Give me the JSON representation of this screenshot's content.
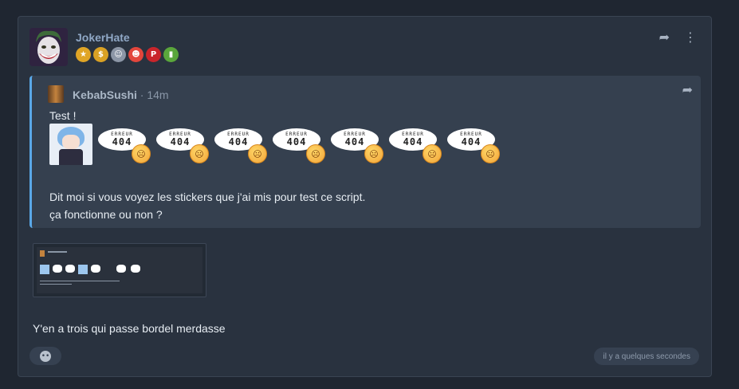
{
  "post": {
    "author": "JokerHate",
    "badges": [
      {
        "icon": "star-badge-icon",
        "glyph": "★",
        "color": "#e0a526"
      },
      {
        "icon": "dollar-badge-icon",
        "glyph": "$",
        "color": "#d9a124"
      },
      {
        "icon": "portrait-badge-icon",
        "glyph": "☺",
        "color": "#8c96a6"
      },
      {
        "icon": "clown-badge-icon",
        "glyph": "☻",
        "color": "#e3463c"
      },
      {
        "icon": "wp-badge-icon",
        "glyph": "P",
        "color": "#c9252b"
      },
      {
        "icon": "trash-badge-icon",
        "glyph": "▮",
        "color": "#5aa63b"
      }
    ],
    "actions": {
      "share_icon": "share-icon",
      "more_icon": "more-vertical-icon"
    },
    "quote": {
      "author": "KebabSushi",
      "time": "14m",
      "line1": "Test !",
      "sticker_word": "ERREUR",
      "sticker_code": "404",
      "line2": "Dit moi si vous voyez les stickers que j'ai mis pour test ce script.",
      "line3": "ça fonctionne ou non ?"
    },
    "body_text": "Y'en a trois qui passe bordel merdasse",
    "timestamp": "il y a quelques secondes",
    "colors": {
      "accent": "#5aa8e8",
      "card": "#29323f",
      "quote_bg": "#35404f"
    }
  }
}
